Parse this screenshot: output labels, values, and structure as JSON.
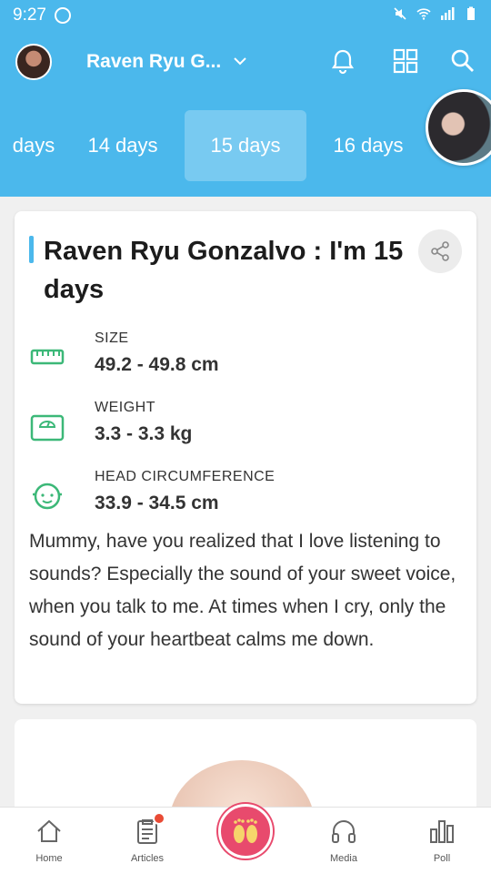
{
  "status_bar": {
    "time": "9:27"
  },
  "header": {
    "child_name": "Raven Ryu G..."
  },
  "tabs": [
    {
      "label": "days"
    },
    {
      "label": "14 days"
    },
    {
      "label": "15 days"
    },
    {
      "label": "16 days"
    }
  ],
  "card": {
    "title": "Raven Ryu Gonzalvo : I'm  15 days",
    "metrics": [
      {
        "label": "SIZE",
        "value": "49.2 - 49.8 cm",
        "icon": "ruler-icon"
      },
      {
        "label": "WEIGHT",
        "value": "3.3 - 3.3 kg",
        "icon": "scale-icon"
      },
      {
        "label": "HEAD CIRCUMFERENCE",
        "value": "33.9 - 34.5 cm",
        "icon": "baby-face-icon"
      }
    ],
    "description": "Mummy, have you realized that I love listening to sounds? Especially the sound of your sweet voice, when you talk to me. At times when I cry, only the sound of your heartbeat calms me down."
  },
  "nav": [
    {
      "label": "Home"
    },
    {
      "label": "Articles"
    },
    {
      "label": ""
    },
    {
      "label": "Media"
    },
    {
      "label": "Poll"
    }
  ],
  "colors": {
    "primary": "#4bb8ec",
    "accent_green": "#3cb878",
    "badge": "#e94b35",
    "center": "#e84a6d"
  }
}
